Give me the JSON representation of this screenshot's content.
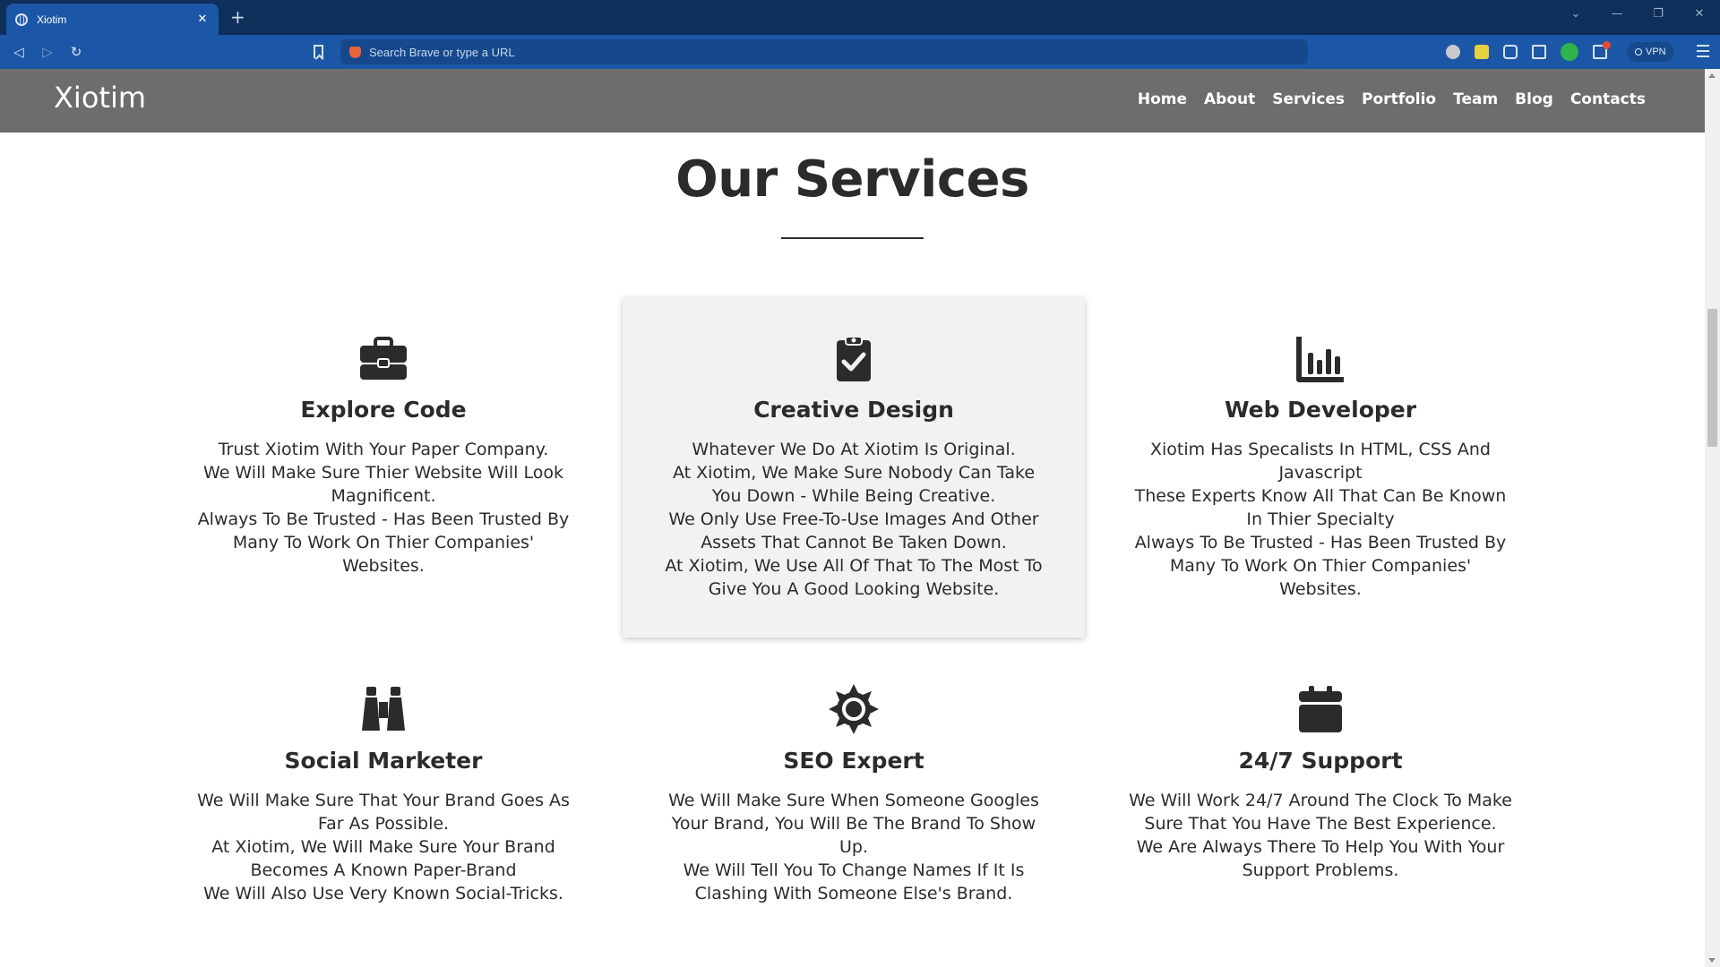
{
  "browser": {
    "tab_title": "Xiotim",
    "tab_close": "✕",
    "new_tab": "+",
    "url_placeholder": "Search Brave or type a URL",
    "vpn_label": "VPN"
  },
  "site": {
    "brand": "Xiotim",
    "nav": [
      "Home",
      "About",
      "Services",
      "Portfolio",
      "Team",
      "Blog",
      "Contacts"
    ]
  },
  "services": {
    "title": "Our Services",
    "cards": [
      {
        "icon": "briefcase-icon",
        "title": "Explore Code",
        "lines": [
          "Trust Xiotim With Your Paper Company.",
          "We Will Make Sure Thier Website Will Look Magnificent.",
          "Always To Be Trusted - Has Been Trusted By Many To Work On Thier Companies' Websites."
        ]
      },
      {
        "icon": "clipboard-check-icon",
        "title": "Creative Design",
        "lines": [
          "Whatever We Do At Xiotim Is Original.",
          "At Xiotim, We Make Sure Nobody Can Take You Down - While Being Creative.",
          "We Only Use Free-To-Use Images And Other Assets That Cannot Be Taken Down.",
          "At Xiotim, We Use All Of That To The Most To Give You A Good Looking Website."
        ]
      },
      {
        "icon": "bar-chart-icon",
        "title": "Web Developer",
        "lines": [
          "Xiotim Has Specalists In HTML, CSS And Javascript",
          "These Experts Know All That Can Be Known In Thier Specialty",
          "Always To Be Trusted - Has Been Trusted By Many To Work On Thier Companies' Websites."
        ]
      },
      {
        "icon": "binoculars-icon",
        "title": "Social Marketer",
        "lines": [
          "We Will Make Sure That Your Brand Goes As Far As Possible.",
          "At Xiotim, We Will Make Sure Your Brand Becomes A Known Paper-Brand",
          "We Will Also Use Very Known Social-Tricks."
        ]
      },
      {
        "icon": "gear-sun-icon",
        "title": "SEO Expert",
        "lines": [
          "We Will Make Sure When Someone Googles Your Brand, You Will Be The Brand To Show Up.",
          "We Will Tell You To Change Names If It Is Clashing With Someone Else's Brand."
        ]
      },
      {
        "icon": "calendar-icon",
        "title": "24/7 Support",
        "lines": [
          "We Will Work 24/7 Around The Clock To Make Sure That You Have The Best Experience.",
          "We Are Always There To Help You With Your Support Problems."
        ]
      }
    ]
  }
}
